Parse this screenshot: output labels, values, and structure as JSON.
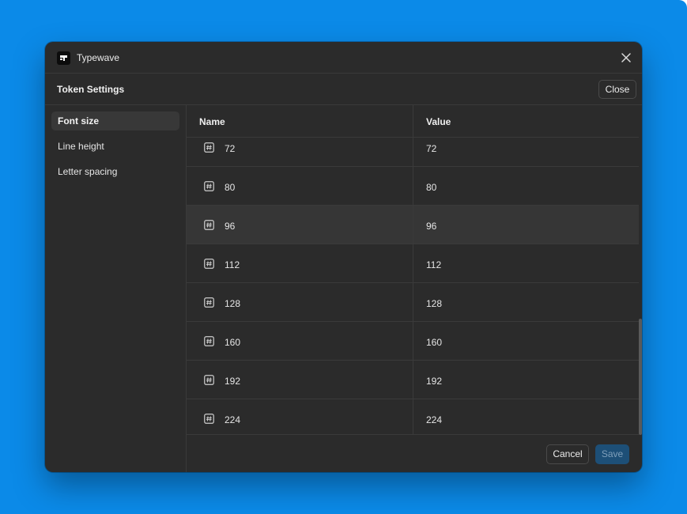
{
  "window": {
    "app_title": "Typewave",
    "app_icon": "typewave-logo-icon",
    "close_icon": "close-icon"
  },
  "header": {
    "title": "Token Settings",
    "close_label": "Close"
  },
  "sidebar": {
    "items": [
      {
        "label": "Font size",
        "active": true
      },
      {
        "label": "Line height",
        "active": false
      },
      {
        "label": "Letter spacing",
        "active": false
      }
    ]
  },
  "table": {
    "columns": [
      "Name",
      "Value"
    ],
    "row_icon": "hash-icon",
    "rows": [
      {
        "name": "72",
        "value": "72"
      },
      {
        "name": "80",
        "value": "80"
      },
      {
        "name": "96",
        "value": "96",
        "highlighted": true
      },
      {
        "name": "112",
        "value": "112"
      },
      {
        "name": "128",
        "value": "128"
      },
      {
        "name": "160",
        "value": "160"
      },
      {
        "name": "192",
        "value": "192"
      },
      {
        "name": "224",
        "value": "224"
      }
    ]
  },
  "footer": {
    "cancel_label": "Cancel",
    "save_label": "Save",
    "save_enabled": false
  },
  "colors": {
    "desktop": "#0b8ae8",
    "window_bg": "#2b2b2b",
    "row_highlight": "#363636",
    "save_disabled": "#1d4f77"
  }
}
